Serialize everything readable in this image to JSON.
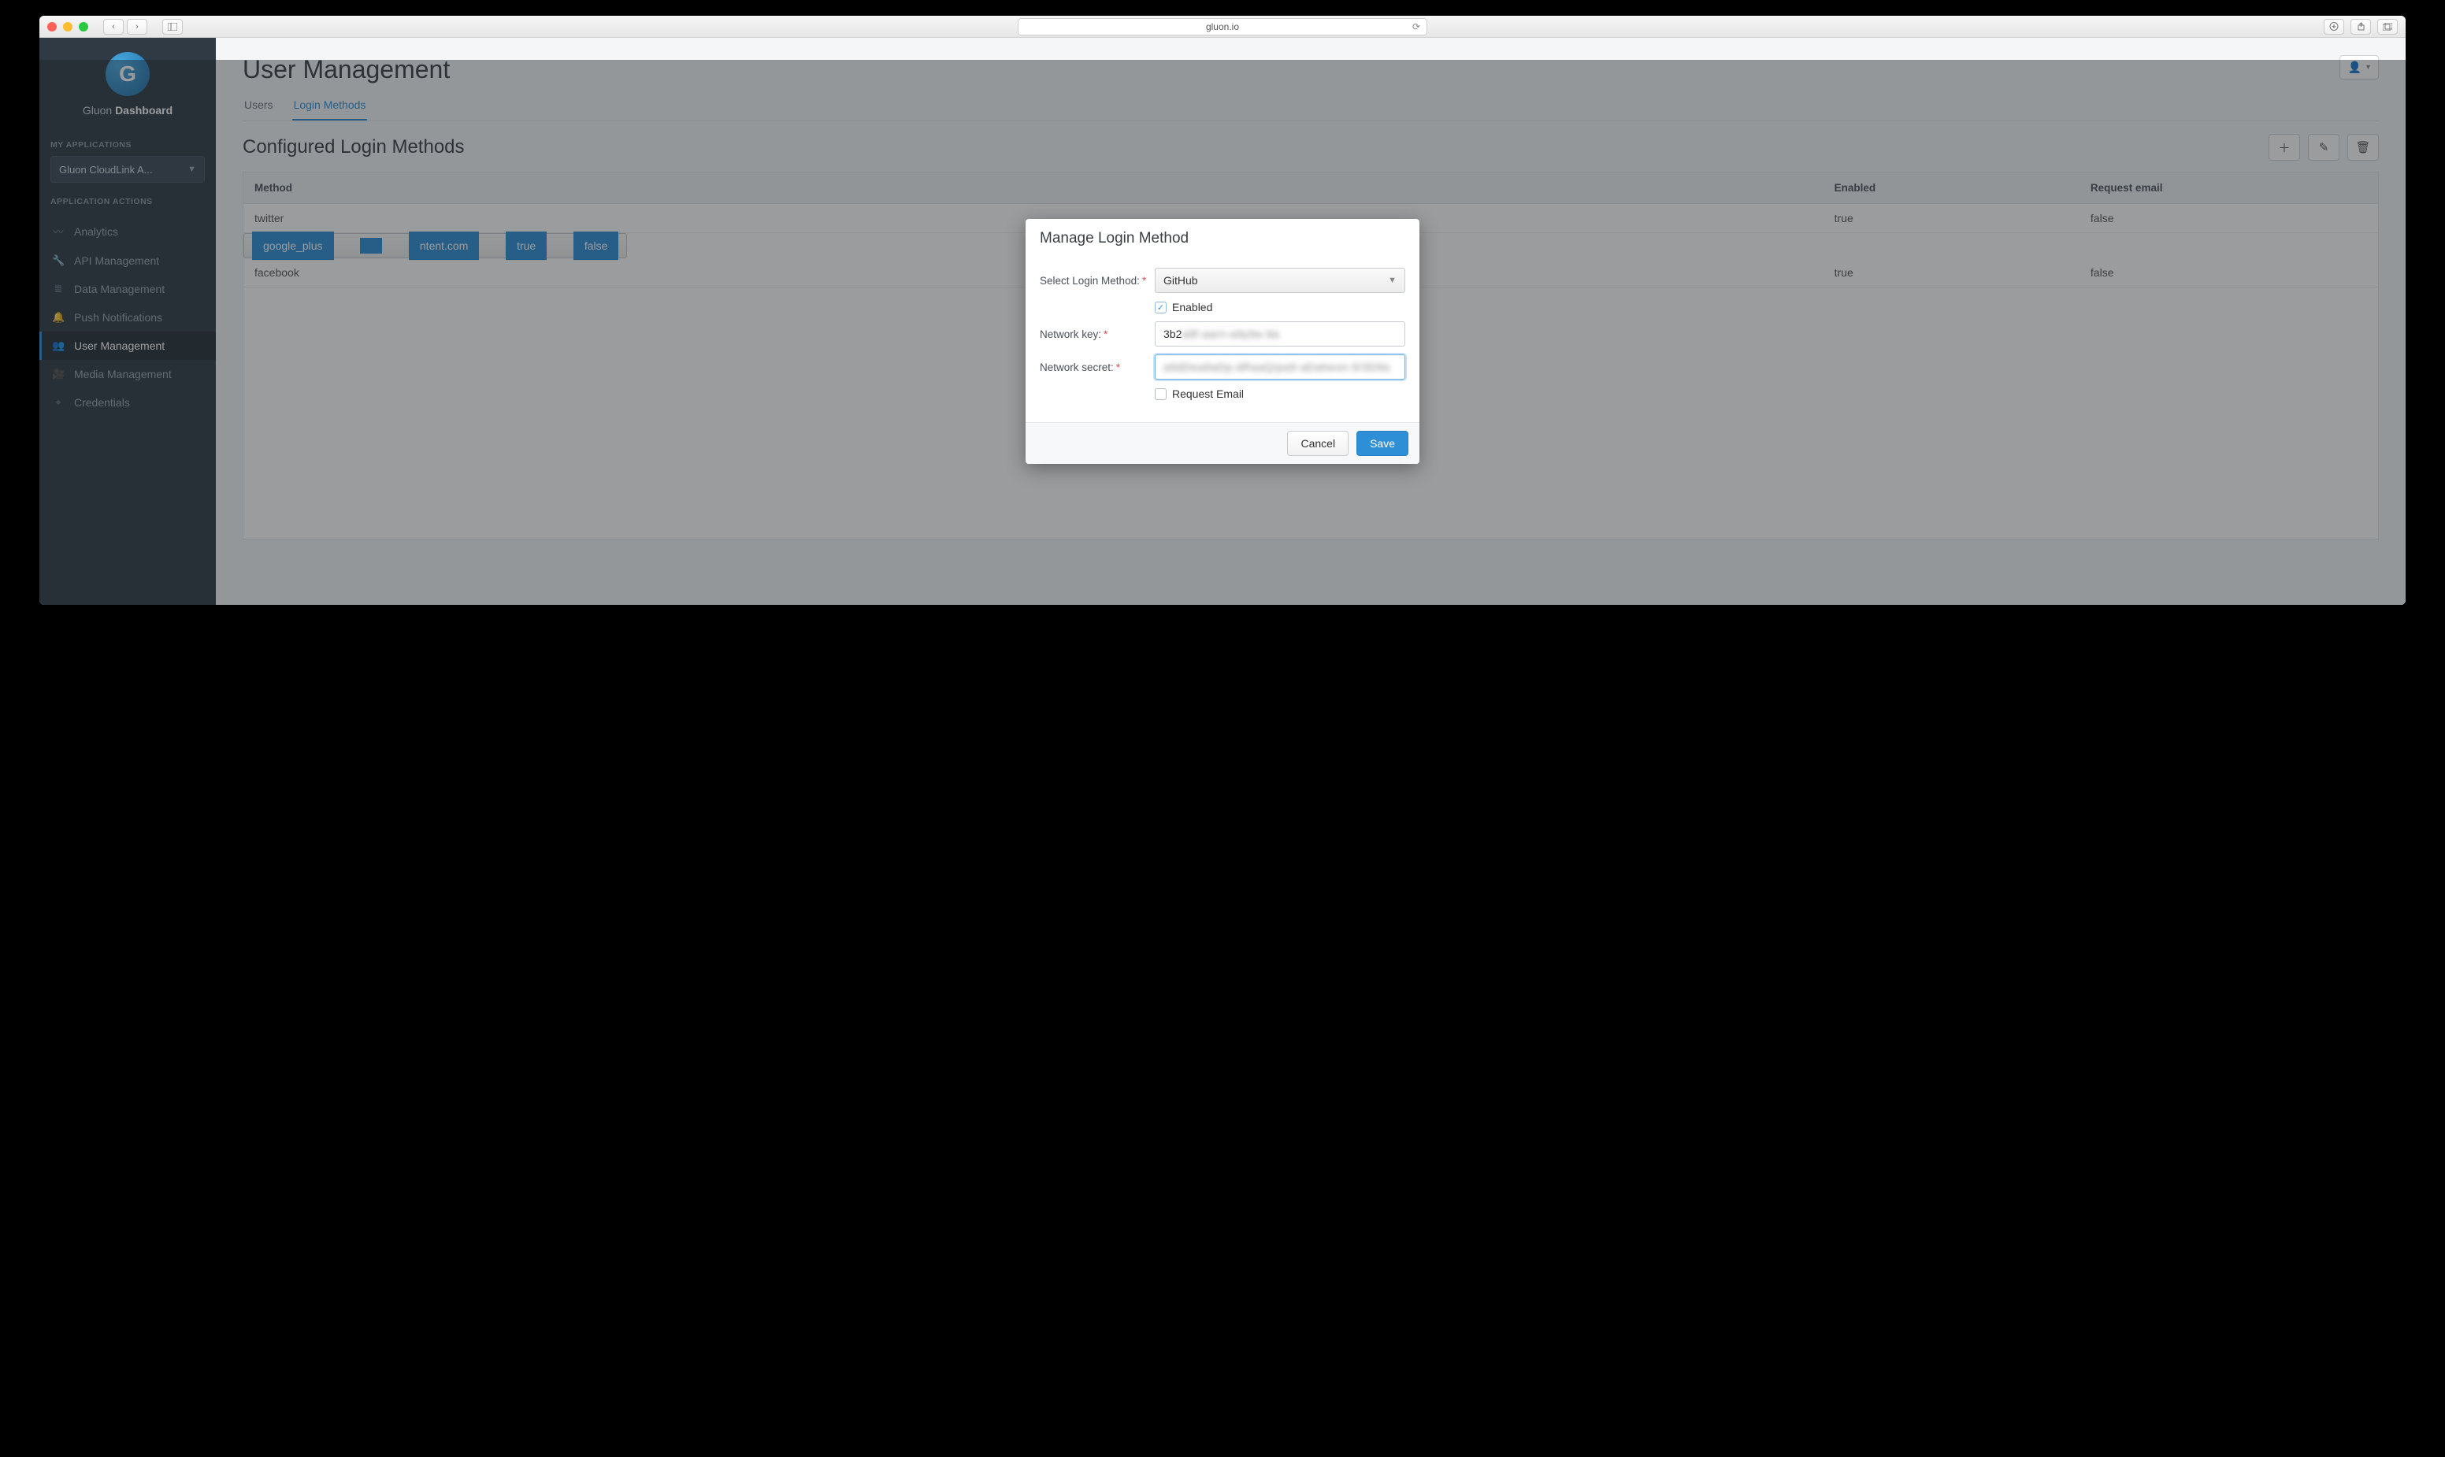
{
  "browser": {
    "url": "gluon.io"
  },
  "brand": {
    "left": "Gluon",
    "right": "Dashboard"
  },
  "sidebar": {
    "label_apps": "MY APPLICATIONS",
    "app_selected": "Gluon CloudLink A...",
    "label_actions": "APPLICATION ACTIONS",
    "items": [
      {
        "icon": "analytics",
        "label": "Analytics"
      },
      {
        "icon": "wrench",
        "label": "API Management"
      },
      {
        "icon": "db",
        "label": "Data Management"
      },
      {
        "icon": "bell",
        "label": "Push Notifications"
      },
      {
        "icon": "users",
        "label": "User Management"
      },
      {
        "icon": "video",
        "label": "Media Management"
      },
      {
        "icon": "key",
        "label": "Credentials"
      }
    ]
  },
  "page": {
    "title": "User Management",
    "tabs": [
      "Users",
      "Login Methods"
    ],
    "active_tab": 1,
    "section_title": "Configured Login Methods"
  },
  "table": {
    "headers": [
      "Method",
      "",
      "",
      "Enabled",
      "Request email"
    ],
    "rows": [
      {
        "method": "twitter",
        "c2": "",
        "c3": "",
        "enabled": "true",
        "request_email": "false",
        "selected": false
      },
      {
        "method": "google_plus",
        "c2": "",
        "c3": "ntent.com",
        "enabled": "true",
        "request_email": "false",
        "selected": true
      },
      {
        "method": "facebook",
        "c2": "",
        "c3": "",
        "enabled": "true",
        "request_email": "false",
        "selected": false
      }
    ]
  },
  "modal": {
    "title": "Manage Login Method",
    "labels": {
      "select_method": "Select Login Method:",
      "enabled": "Enabled",
      "network_key": "Network key:",
      "network_secret": "Network secret:",
      "request_email": "Request Email"
    },
    "values": {
      "method": "GitHub",
      "enabled": true,
      "network_key_visible": "3b2",
      "network_key_blur": "a9f-aarn-a9y9a-9a",
      "network_secret_blur": "a9dDea9aDp-dRaaQ/pa9-aDaheon-9/3D9a",
      "request_email": false
    },
    "buttons": {
      "cancel": "Cancel",
      "save": "Save"
    }
  }
}
